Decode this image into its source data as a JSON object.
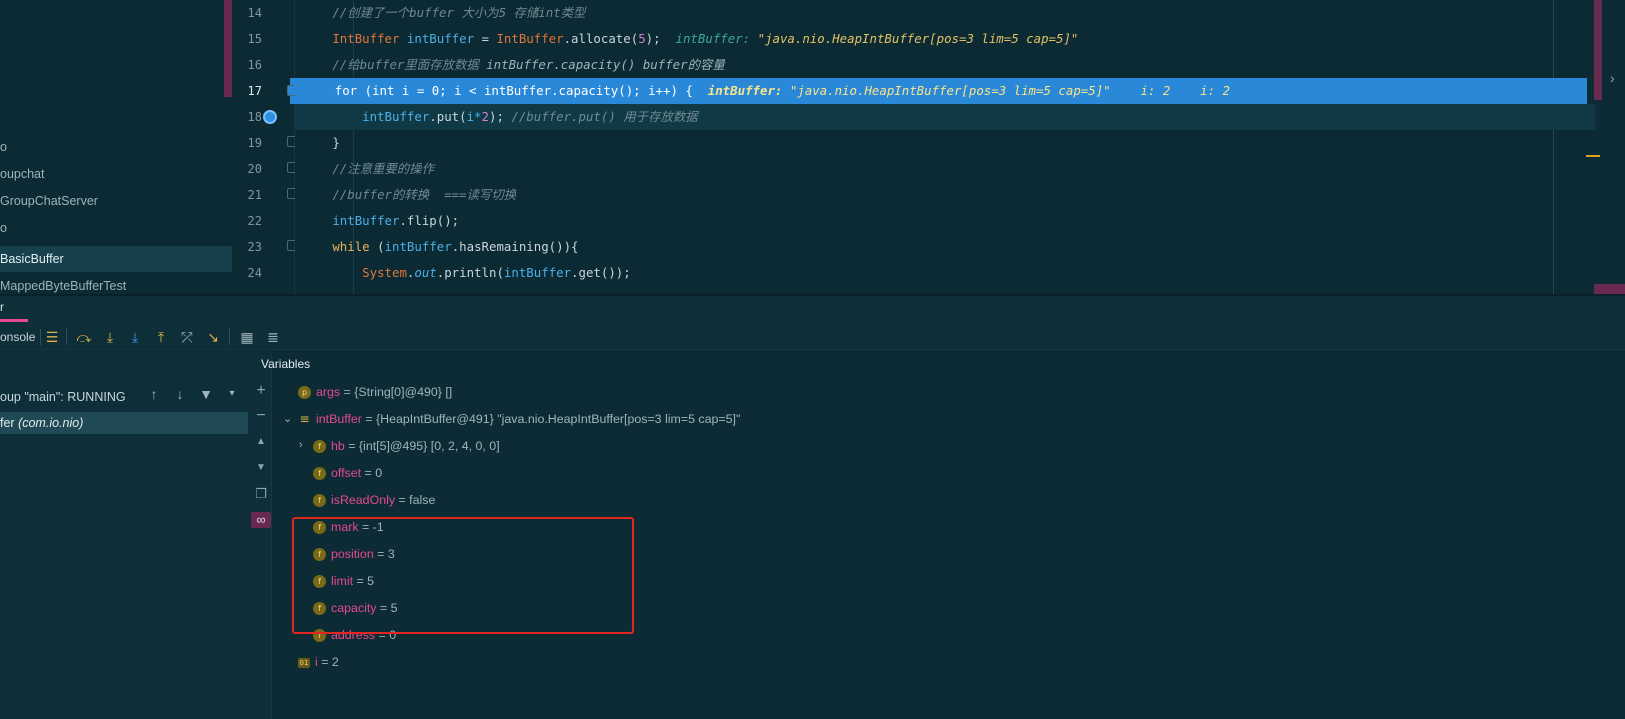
{
  "project_tree": {
    "items": [
      {
        "label": "o"
      },
      {
        "label": "oupchat"
      },
      {
        "label": "GroupChatServer"
      },
      {
        "label": "o"
      },
      {
        "label": "BasicBuffer"
      },
      {
        "label": "MappedByteBufferTest"
      }
    ]
  },
  "editor": {
    "line_numbers": [
      "14",
      "15",
      "16",
      "17",
      "18",
      "19",
      "20",
      "21",
      "22",
      "23",
      "24"
    ],
    "lines": [
      {
        "comment": "//创建了一个buffer 大小为5 存储int类型"
      },
      {
        "type1": "IntBuffer",
        "var": "intBuffer",
        "eq": " = ",
        "type2": "IntBuffer",
        "call": ".allocate(",
        "num": "5",
        "end": ");",
        "inline_name": "intBuffer:",
        "inline_value": "\"java.nio.HeapIntBuffer[pos=3 lim=5 cap=5]\""
      },
      {
        "comment_pre": "//给buffer里面存放数据 ",
        "comment_code": "intBuffer.capacity() buffer的容量"
      },
      {
        "code": "for (int i = 0; i < intBuffer.capacity(); i++) {",
        "inline_name": "intBuffer:",
        "inline_value": "\"java.nio.HeapIntBuffer[pos=3 lim=5 cap=5]\"",
        "inline_i1": "i: 2",
        "inline_i2": "i: 2"
      },
      {
        "var": "intBuffer",
        "call": ".put(",
        "arg": "i*",
        "num": "2",
        "end": ");",
        "comment": " //buffer.put() 用于存放数据"
      },
      {
        "code": "}"
      },
      {
        "comment": "//注意重要的操作"
      },
      {
        "comment": "//buffer的转换  ===读写切换"
      },
      {
        "var": "intBuffer",
        "rest": ".flip();"
      },
      {
        "kw": "while",
        "open": " (",
        "var": "intBuffer",
        "rest": ".hasRemaining()){"
      },
      {
        "type": "System",
        "dot": ".",
        "field": "out",
        "call": ".println(",
        "var": "intBuffer",
        "rest": ".get());"
      }
    ]
  },
  "debug": {
    "tab_label": "r",
    "console_label": "onsole",
    "thread_label": "oup \"main\": RUNNING",
    "frame_label": "fer ",
    "frame_pkg": "(com.io.nio)",
    "variables_title": "Variables",
    "variables": [
      {
        "icon": "p",
        "name": "args",
        "eq": " = ",
        "value": "{String[0]@490} []"
      },
      {
        "icon": "≡",
        "name": "intBuffer",
        "eq": " = ",
        "value": "{HeapIntBuffer@491} \"java.nio.HeapIntBuffer[pos=3 lim=5 cap=5]\""
      },
      {
        "icon": "f",
        "name": "hb",
        "eq": " = ",
        "value": "{int[5]@495} [0, 2, 4, 0, 0]"
      },
      {
        "icon": "f",
        "name": "offset",
        "eq": " = ",
        "value": "0"
      },
      {
        "icon": "f",
        "name": "isReadOnly",
        "eq": " = ",
        "value": "false"
      },
      {
        "icon": "f",
        "name": "mark",
        "eq": " = ",
        "value": "-1"
      },
      {
        "icon": "f",
        "name": "position",
        "eq": " = ",
        "value": "3"
      },
      {
        "icon": "f",
        "name": "limit",
        "eq": " = ",
        "value": "5"
      },
      {
        "icon": "f",
        "name": "capacity",
        "eq": " = ",
        "value": "5"
      },
      {
        "icon": "f",
        "name": "address",
        "eq": " = ",
        "value": "0"
      },
      {
        "icon": "01",
        "name": "i",
        "eq": " = ",
        "value": "2"
      }
    ]
  },
  "colors": {
    "exec_line": "#2a88d8",
    "highlight_box": "#e0261e",
    "accent_pink": "#e44a91"
  }
}
